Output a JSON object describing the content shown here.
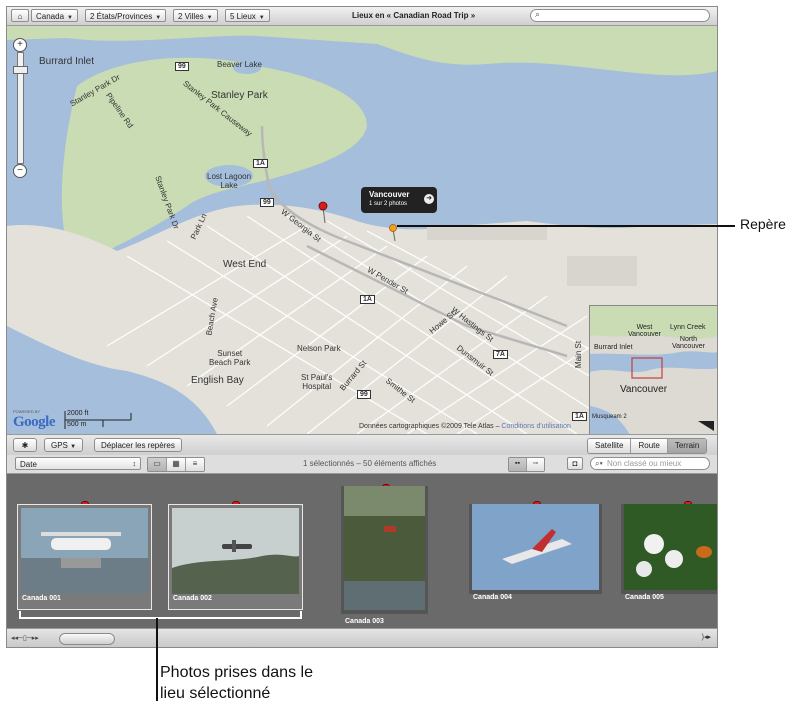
{
  "topbar": {
    "crumbs": [
      "Canada",
      "2 États/Provinces",
      "2 Villes",
      "5 Lieux"
    ],
    "title": "Lieux en « Canadian Road Trip »"
  },
  "map": {
    "labels": {
      "burrard_inlet": "Burrard Inlet",
      "beaver_lake": "Beaver Lake",
      "stanley_park": "Stanley Park",
      "stanley_park_causeway": "Stanley Park Causeway",
      "lost_lagoon": "Lost Lagoon\nLake",
      "park_ln": "Park Ln",
      "pipeline_rd": "Pipeline Rd",
      "stanley_park_dr": "Stanley Park Dr",
      "stanley_park_dr_2": "Stanley Park Dr",
      "west_end": "West End",
      "w_georgia": "W Georgia St",
      "w_pender": "W Pender St",
      "howe": "Howe St",
      "w_hastings": "W Hastings St",
      "dunsmuir": "Dunsmuir St",
      "nelson_park": "Nelson Park",
      "sunset_beach": "Sunset\nBeach Park",
      "english_bay": "English Bay",
      "st_pauls": "St Paul's\nHospital",
      "burrard_st": "Burrard St",
      "smithe": "Smithe St",
      "main_st": "Main St",
      "beach_ave": "Beach Ave"
    },
    "highway_shields": [
      "99",
      "1A",
      "99",
      "1A",
      "7A",
      "99",
      "1A"
    ],
    "callout": {
      "title": "Vancouver",
      "subtitle": "1 sur 2 photos"
    },
    "google": {
      "powered_by": "POWERED BY",
      "logo": "Google"
    },
    "scale": {
      "ft": "2000 ft",
      "m": "500 m"
    },
    "attribution": "Données cartographiques ©2009 Tele Atlas",
    "attribution_link": "Conditions d'utilisation",
    "minimap": {
      "labels": [
        "West\nVancouver",
        "Lynn Creek",
        "North\nVancouver",
        "Burrard Inlet",
        "Vancouver",
        "Musqueam 2"
      ]
    }
  },
  "toolbar": {
    "gear": "✱",
    "gps_label": "GPS",
    "move_pins_label": "Déplacer les repères",
    "map_types": [
      "Satellite",
      "Route",
      "Terrain"
    ],
    "map_type_selected": "Terrain"
  },
  "toolbar2": {
    "sort_label": "Date",
    "status": "1 sélectionnés – 50 éléments affichés",
    "filter_placeholder": "Non classé ou mieux"
  },
  "photos": [
    {
      "caption": "Canada 001",
      "selected": true
    },
    {
      "caption": "Canada 002",
      "selected": true
    },
    {
      "caption": "Canada 003",
      "selected": false
    },
    {
      "caption": "Canada 004",
      "selected": false
    },
    {
      "caption": "Canada 005",
      "selected": false
    }
  ],
  "annotations": {
    "pin": "Repère",
    "photos_line1": "Photos prises dans le",
    "photos_line2": "lieu sélectionné"
  },
  "colors": {
    "water": "#a4bedb",
    "park": "#c9dcb3",
    "land": "#e4e1da",
    "pin_red": "#d02020",
    "pin_yellow": "#f0a020"
  }
}
